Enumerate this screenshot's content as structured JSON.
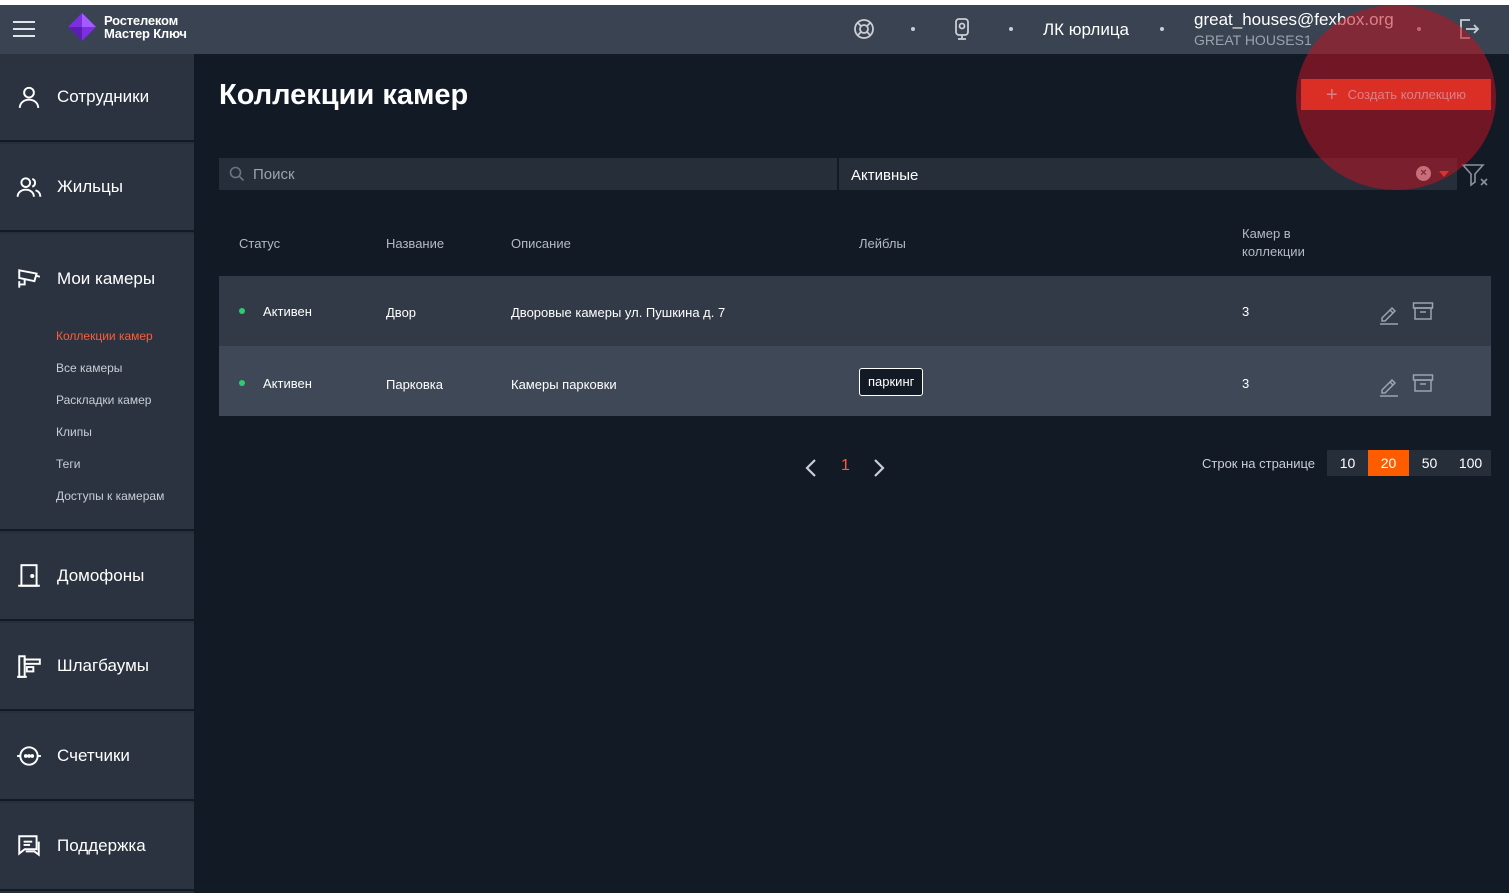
{
  "brand": {
    "line1": "Ростелеком",
    "line2": "Мастер Ключ"
  },
  "header": {
    "org_label": "ЛК юрлица",
    "user_email": "great_houses@fexbox.org",
    "user_org": "GREAT HOUSES1"
  },
  "sidebar": {
    "items": [
      {
        "label": "Сотрудники",
        "icon": "person-icon"
      },
      {
        "label": "Жильцы",
        "icon": "people-icon"
      },
      {
        "label": "Мои камеры",
        "icon": "camera-icon"
      },
      {
        "label": "Домофоны",
        "icon": "door-icon"
      },
      {
        "label": "Шлагбаумы",
        "icon": "barrier-icon"
      },
      {
        "label": "Счетчики",
        "icon": "meter-icon"
      },
      {
        "label": "Поддержка",
        "icon": "chat-icon"
      }
    ],
    "camera_sub": [
      "Коллекции камер",
      "Все камеры",
      "Раскладки камер",
      "Клипы",
      "Теги",
      "Доступы к камерам"
    ]
  },
  "main": {
    "title": "Коллекции камер",
    "create_button": "Создать коллекцию",
    "search_placeholder": "Поиск",
    "status_filter": "Активные",
    "columns": {
      "status": "Статус",
      "name": "Название",
      "description": "Описание",
      "labels": "Лейблы",
      "count_line1": "Камер в",
      "count_line2": "коллекции"
    },
    "rows": [
      {
        "status": "Активен",
        "name": "Двор",
        "description": "Дворовые камеры ул. Пушкина д. 7",
        "label": "",
        "count": "3"
      },
      {
        "status": "Активен",
        "name": "Парковка",
        "description": "Камеры парковки",
        "label": "паркинг",
        "count": "3"
      }
    ]
  },
  "pagination": {
    "current_page": "1",
    "rows_per_page_label": "Строк на странице",
    "options": [
      "10",
      "20",
      "50",
      "100"
    ],
    "selected": "20"
  },
  "colors": {
    "accent": "#ff4f29",
    "active_status": "#2ecc71",
    "background": "#121a26",
    "sidebar": "#2b3340"
  }
}
